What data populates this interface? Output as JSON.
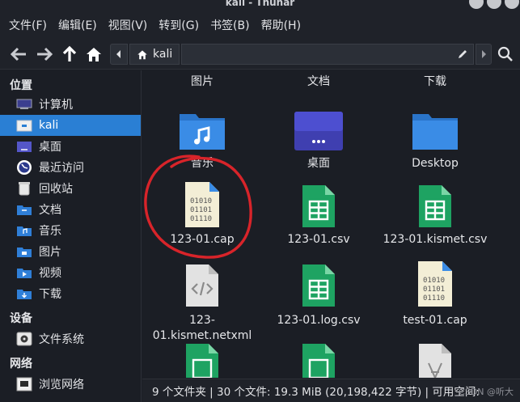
{
  "window": {
    "title": "kali - Thunar"
  },
  "menubar": {
    "items": [
      "文件(F)",
      "编辑(E)",
      "视图(V)",
      "转到(G)",
      "书签(B)",
      "帮助(H)"
    ]
  },
  "toolbar": {
    "path_button": "kali"
  },
  "sidebar": {
    "sections": {
      "places": "位置",
      "devices": "设备",
      "network": "网络"
    },
    "places": [
      "计算机",
      "kali",
      "桌面",
      "最近访问",
      "回收站",
      "文档",
      "音乐",
      "图片",
      "视频",
      "下载"
    ],
    "devices": [
      "文件系统"
    ],
    "network": [
      "浏览网络"
    ]
  },
  "files": {
    "row0": [
      "图片",
      "文档",
      "下载"
    ],
    "row1": [
      "音乐",
      "桌面",
      "Desktop"
    ],
    "row2": [
      "123-01.cap",
      "123-01.csv",
      "123-01.kismet.csv"
    ],
    "row3": [
      "123-01.kismet.netxml",
      "123-01.log.csv",
      "test-01.cap"
    ]
  },
  "colors": {
    "selection": "#2a7fd4",
    "folder": "#2f7fd8",
    "spreadsheet": "#1ea362",
    "annotation": "#d8242a"
  },
  "statusbar": {
    "text": "9 个文件夹 | 30 个文件: 19.3 MiB (20,198,422 字节) | 可用空间:"
  },
  "watermark": "CSDN @听大"
}
